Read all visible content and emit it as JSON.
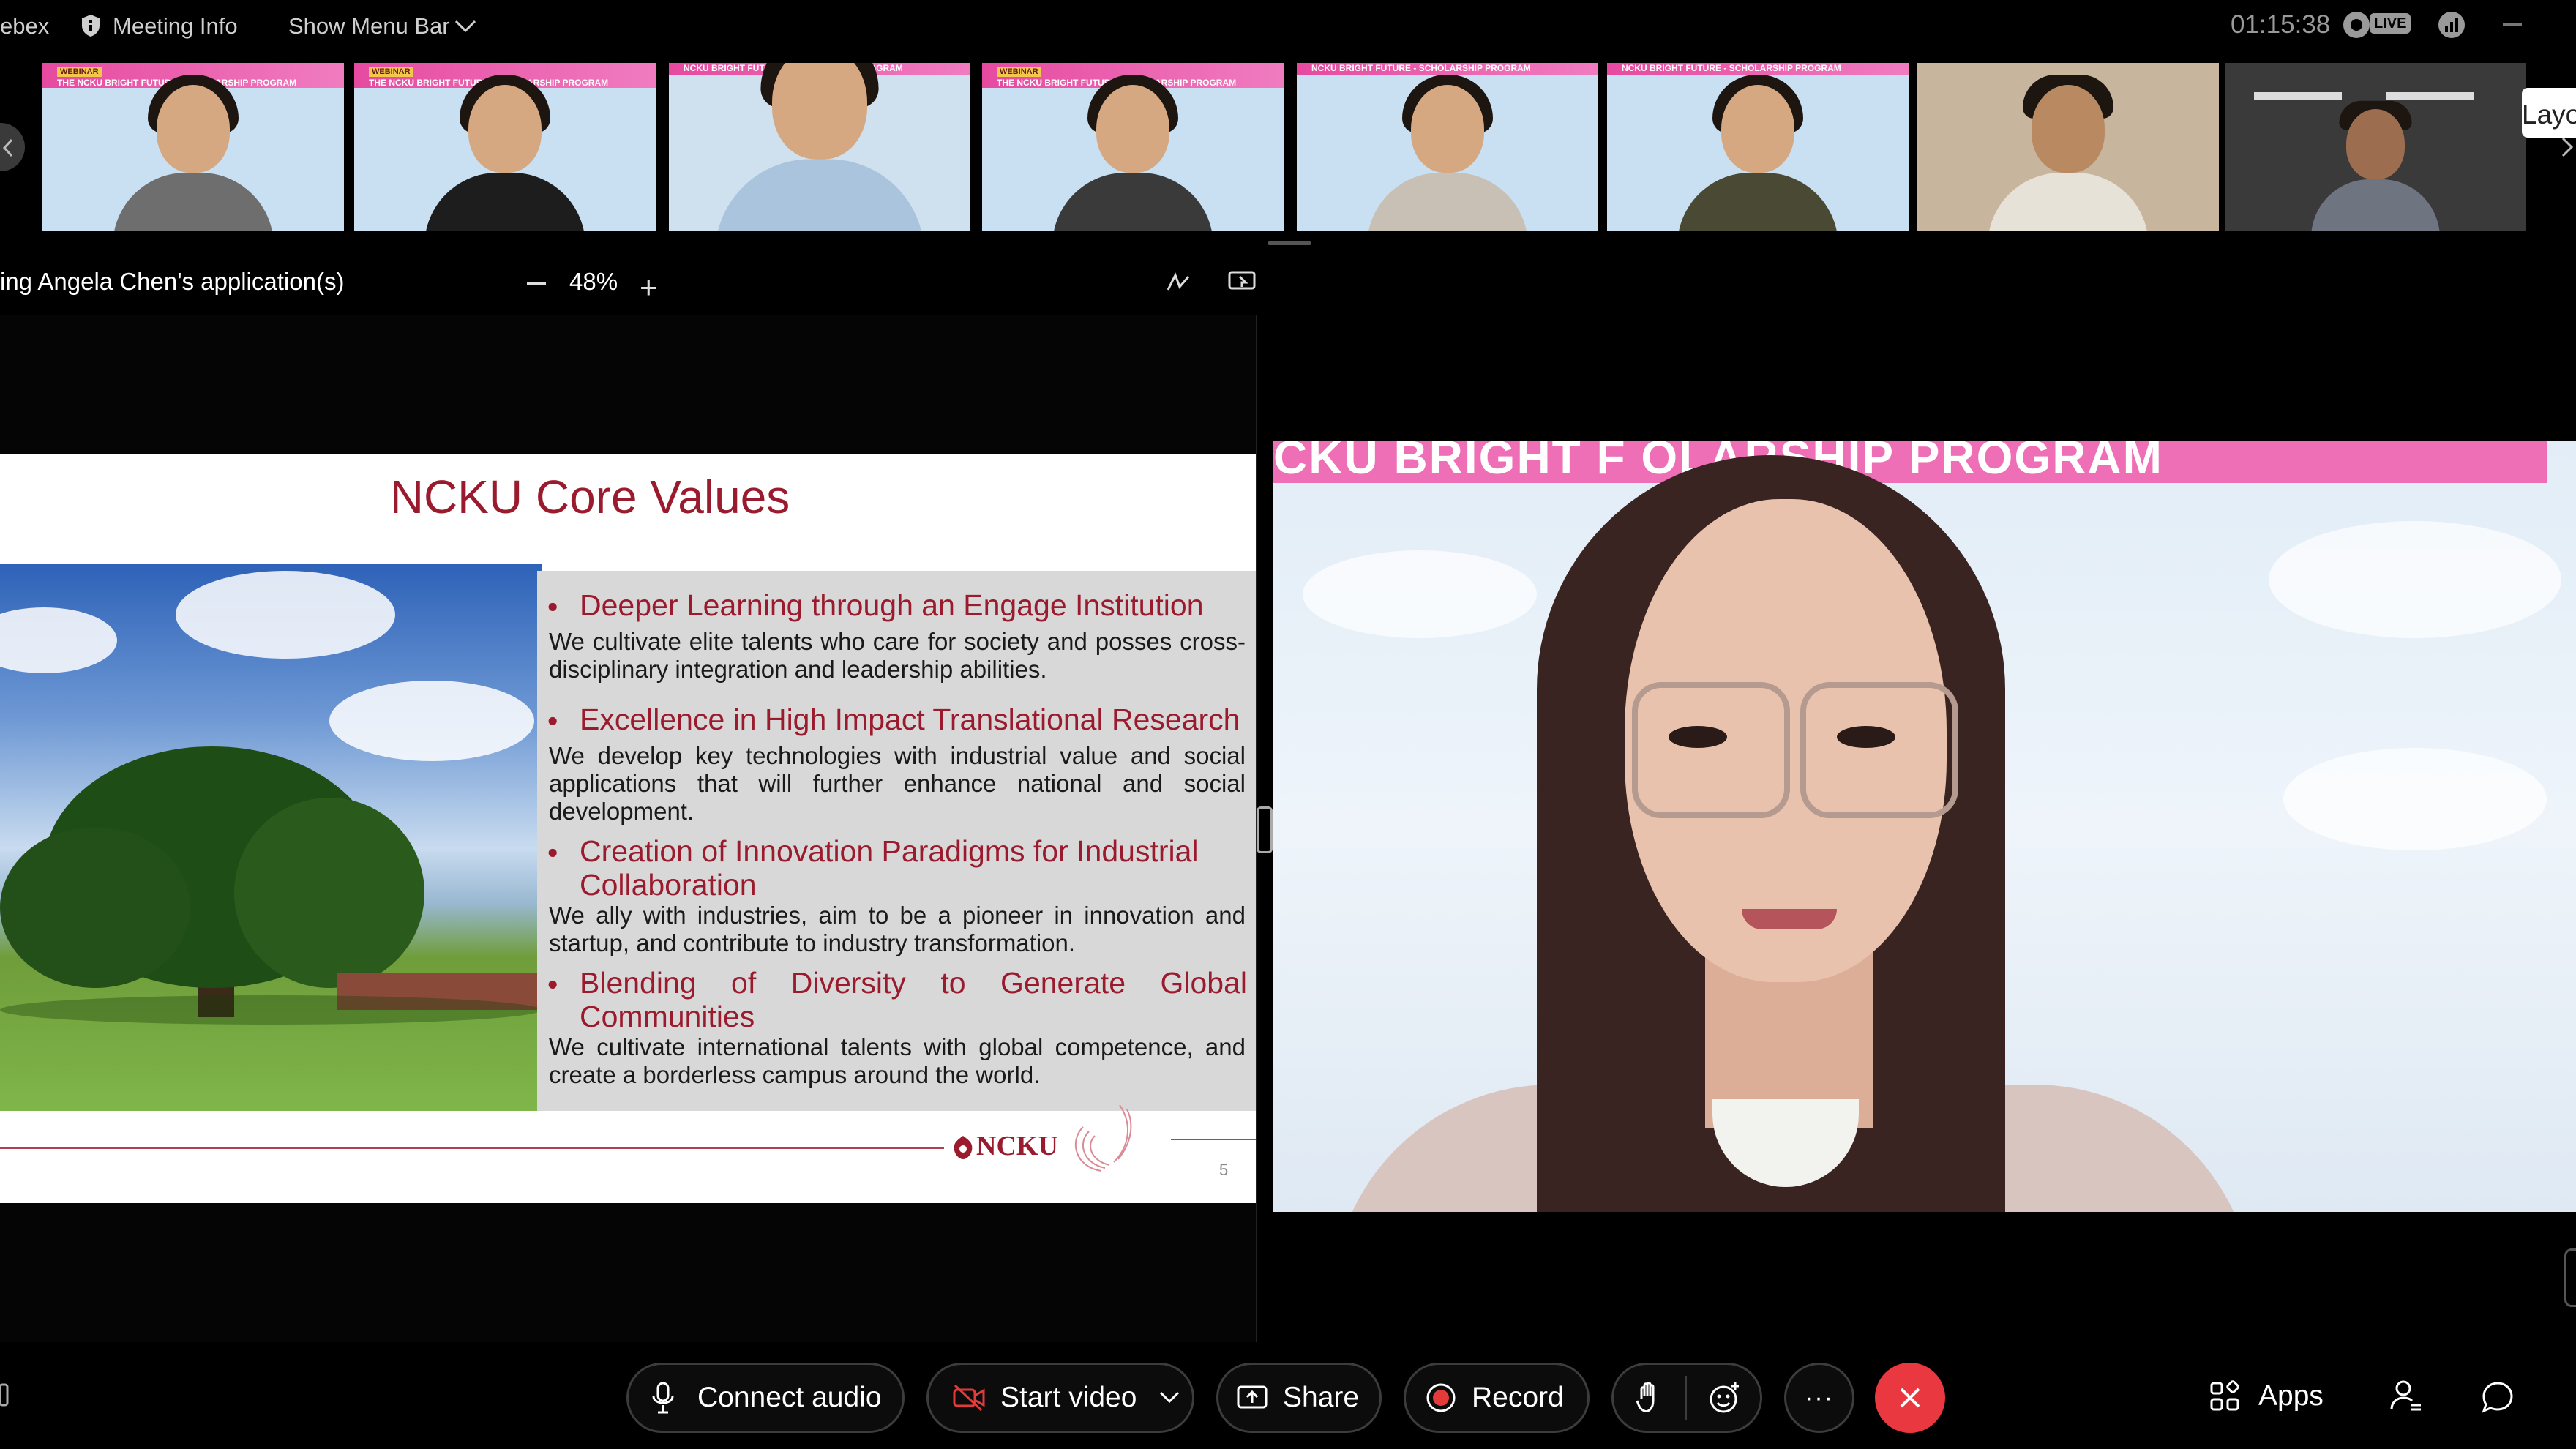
{
  "topbar": {
    "app_name": "ebex",
    "meeting_info": "Meeting Info",
    "show_menu_bar": "Show Menu Bar",
    "timer": "01:15:38",
    "live_badge": "LIVE"
  },
  "filmstrip": {
    "layout_label": "Layo",
    "tiles": [
      {
        "banner": "THE NCKU BRIGHT FUTURE - SCHOLARSHIP PROGRAM",
        "badge": "WEBINAR"
      },
      {
        "banner": "THE NCKU BRIGHT FUTURE - SCHOLARSHIP PROGRAM",
        "badge": "WEBINAR"
      },
      {
        "banner": "NCKU BRIGHT FUTURE - SCHOLARSHIP PROGRAM",
        "badge": ""
      },
      {
        "banner": "THE NCKU BRIGHT FUTURE - SCHOLARSHIP PROGRAM",
        "badge": "WEBINAR"
      },
      {
        "banner": "NCKU BRIGHT FUTURE - SCHOLARSHIP PROGRAM",
        "badge": ""
      },
      {
        "banner": "NCKU BRIGHT FUTURE - SCHOLARSHIP PROGRAM",
        "badge": ""
      },
      {
        "banner": "",
        "badge": ""
      },
      {
        "banner": "",
        "badge": ""
      }
    ]
  },
  "share": {
    "title": "ing Angela Chen's application(s)",
    "zoom": "48%"
  },
  "slide": {
    "title": "NCKU Core Values",
    "items": [
      {
        "head": "Deeper Learning through an Engage Institution",
        "body": "We cultivate elite talents who care for society and posses cross-disciplinary integration and leadership abilities."
      },
      {
        "head": "Excellence in High Impact Translational Research",
        "body": "We develop key technologies with industrial value and social applications that will further enhance national and social development."
      },
      {
        "head": "Creation of Innovation Paradigms for Industrial Collaboration",
        "body": "We ally with industries, aim to be a pioneer in innovation and startup, and contribute to industry transformation."
      },
      {
        "head": "Blending of Diversity to Generate Global Communities",
        "body": "We cultivate international talents with global competence, and create a borderless campus around the world."
      }
    ],
    "logo": "NCKU",
    "page_number": "5"
  },
  "speaker": {
    "banner": "CKU BRIGHT F          OLARSHIP PROGRAM"
  },
  "controls": {
    "connect_audio": "Connect audio",
    "start_video": "Start video",
    "share": "Share",
    "record": "Record",
    "more": "···",
    "apps": "Apps"
  },
  "colors": {
    "slide_red": "#9b1b2e",
    "end_call": "#e9383f",
    "banner_pink": "#ee6fb6",
    "record_red": "#e33a3a"
  }
}
